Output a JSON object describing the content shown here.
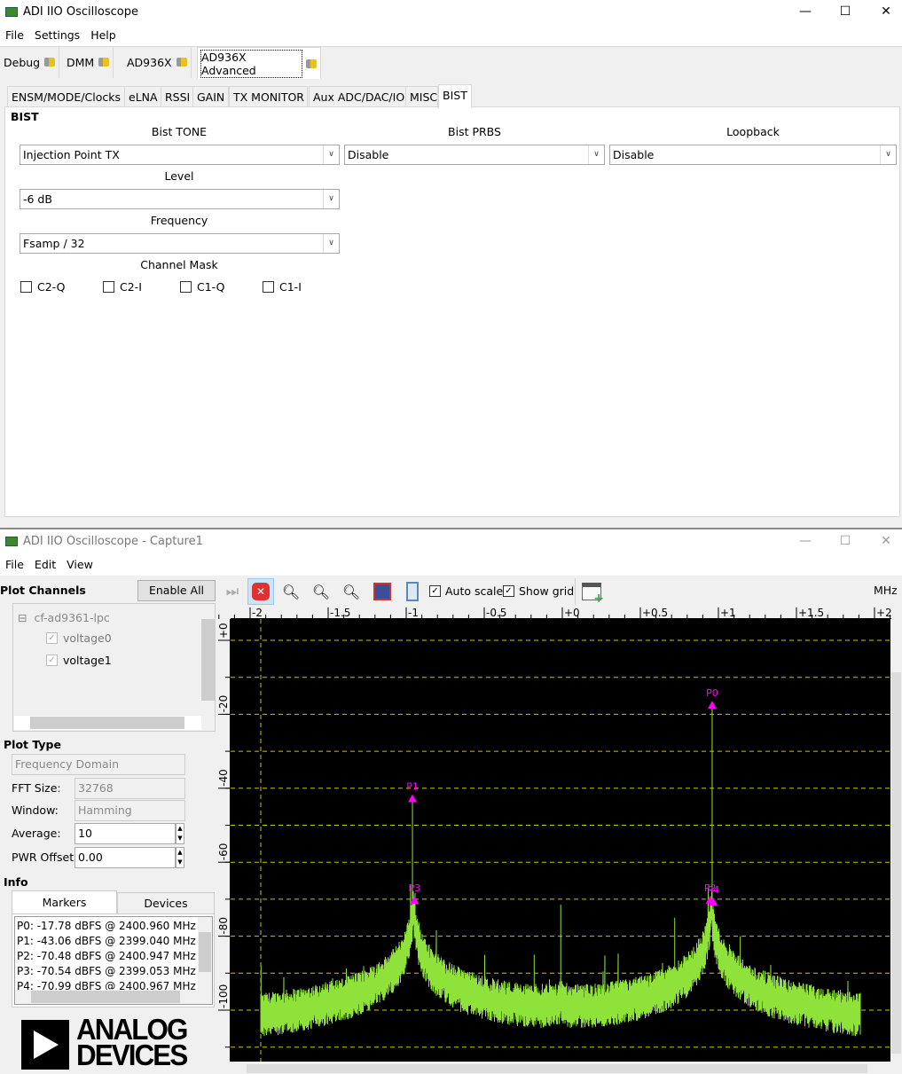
{
  "main_window": {
    "title": "ADI IIO Oscilloscope",
    "window_controls": {
      "minimize": "—",
      "maximize": "☐",
      "close": "✕"
    },
    "menu": [
      "File",
      "Settings",
      "Help"
    ],
    "device_tabs": [
      "Debug",
      "DMM",
      "AD936X",
      "AD936X Advanced"
    ],
    "active_device_tab": "AD936X Advanced",
    "sub_tabs": [
      "ENSM/MODE/Clocks",
      "eLNA",
      "RSSI",
      "GAIN",
      "TX MONITOR",
      "Aux ADC/DAC/IO",
      "MISC",
      "BIST"
    ],
    "active_sub_tab": "BIST",
    "bist": {
      "section_title": "BIST",
      "tone_label": "Bist TONE",
      "tone_value": "Injection Point TX",
      "prbs_label": "Bist PRBS",
      "prbs_value": "Disable",
      "loopback_label": "Loopback",
      "loopback_value": "Disable",
      "level_label": "Level",
      "level_value": "-6 dB",
      "frequency_label": "Frequency",
      "frequency_value": "Fsamp / 32",
      "channel_mask_label": "Channel Mask",
      "channels": [
        {
          "label": "C2-Q",
          "checked": false
        },
        {
          "label": "C2-I",
          "checked": false
        },
        {
          "label": "C1-Q",
          "checked": false
        },
        {
          "label": "C1-I",
          "checked": false
        }
      ]
    }
  },
  "capture_window": {
    "title": "ADI IIO Oscilloscope - Capture1",
    "menu": [
      "File",
      "Edit",
      "View"
    ],
    "toolbar": {
      "auto_scale_label": "Auto scale",
      "auto_scale_checked": true,
      "show_grid_label": "Show grid",
      "show_grid_checked": true,
      "unit": "MHz"
    },
    "plot_channels": {
      "title": "Plot Channels",
      "enable_all": "Enable All",
      "device": "cf-ad9361-lpc",
      "channels": [
        {
          "label": "voltage0",
          "checked": true
        },
        {
          "label": "voltage1",
          "checked": true
        }
      ]
    },
    "plot_type": {
      "title": "Plot Type",
      "value": "Frequency Domain",
      "fft_size_label": "FFT Size:",
      "fft_size": "32768",
      "window_label": "Window:",
      "window": "Hamming",
      "average_label": "Average:",
      "average": "10",
      "pwr_offset_label": "PWR Offset:",
      "pwr_offset": "0.00"
    },
    "info": {
      "title": "Info",
      "tabs": [
        "Markers",
        "Devices"
      ],
      "active_tab": "Markers",
      "markers": [
        "P0: -17.78 dBFS @ 2400.960 MHz",
        "P1: -43.06 dBFS @ 2399.040 MHz",
        "P2: -70.48 dBFS @ 2400.947 MHz",
        "P3: -70.54 dBFS @ 2399.053 MHz",
        "P4: -70.99 dBFS @ 2400.967 MHz"
      ]
    },
    "logo": "ANALOG DEVICES"
  },
  "chart_data": {
    "type": "line",
    "x_unit": "MHz",
    "x_ticks": [
      "-2",
      "-1.5",
      "-1",
      "-0.5",
      "+0",
      "+0.5",
      "+1",
      "+1.5",
      "+2"
    ],
    "y_ticks": [
      "+0",
      "-20",
      "-40",
      "-60",
      "-80",
      "-100"
    ],
    "xlim": [
      -2.1,
      2.1
    ],
    "ylim": [
      -114,
      6
    ],
    "grid": true,
    "trace_color": "#8fe23a",
    "marker_color": "#ff00ff",
    "grid_color": "#c8c800",
    "markers": [
      {
        "name": "P0",
        "x": 0.96,
        "y": -17.78
      },
      {
        "name": "P1",
        "x": -0.96,
        "y": -43.06
      },
      {
        "name": "P2",
        "x": 0.947,
        "y": -70.48
      },
      {
        "name": "P3",
        "x": -0.947,
        "y": -70.54
      },
      {
        "name": "P4",
        "x": 0.967,
        "y": -70.99
      }
    ]
  }
}
